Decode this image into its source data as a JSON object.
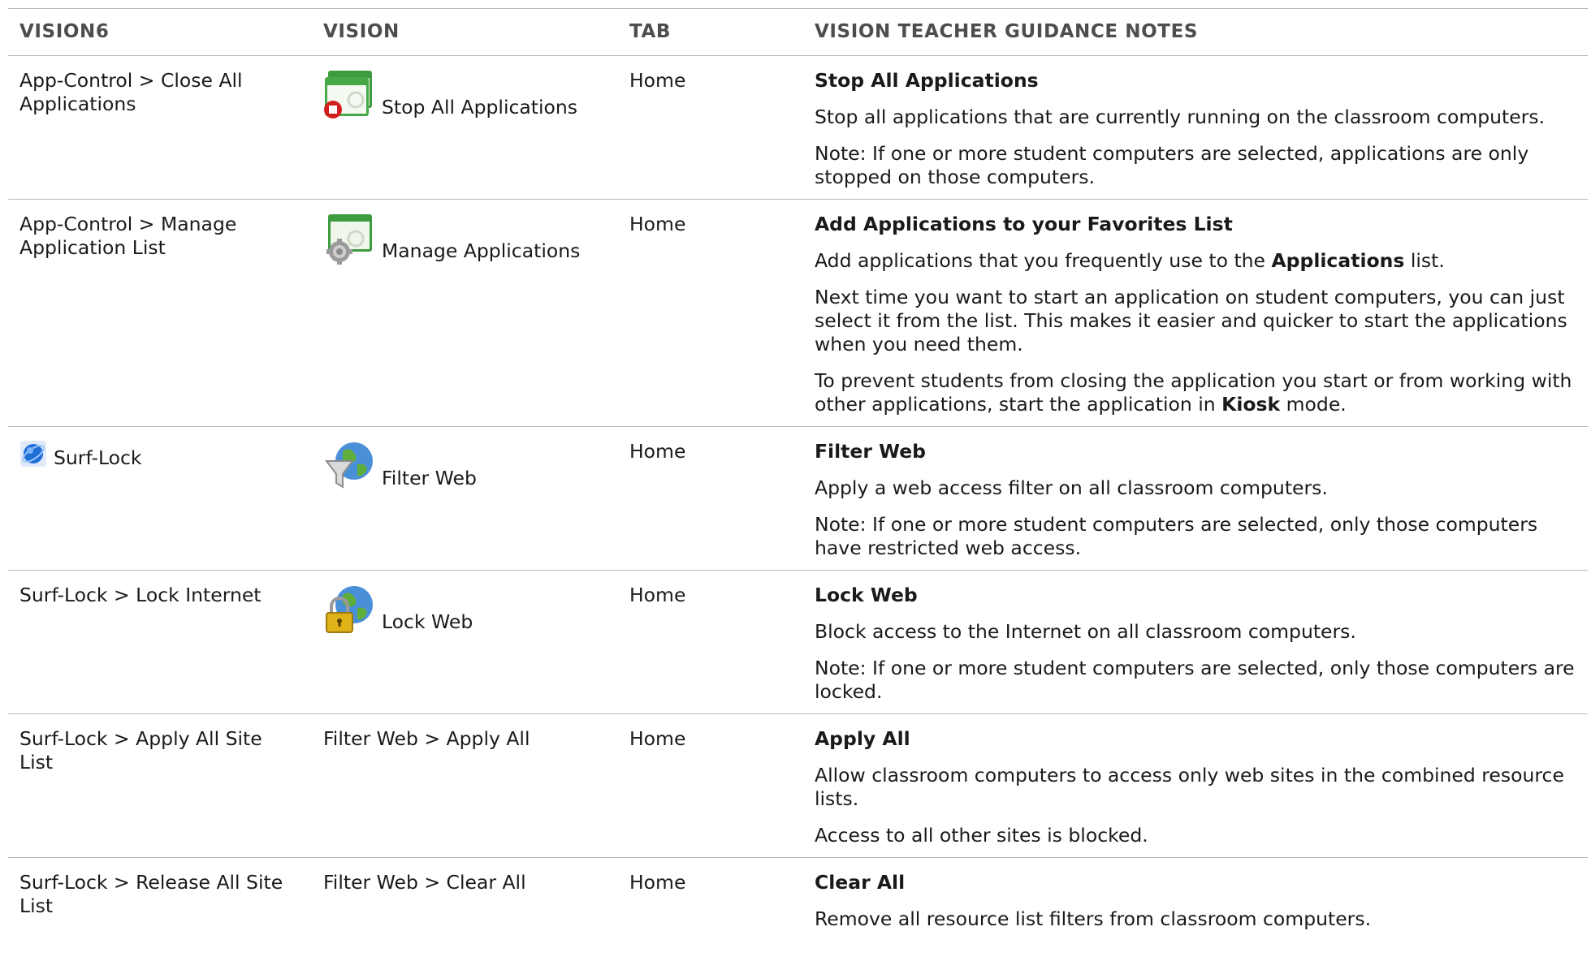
{
  "headers": {
    "vision6": "VISION6",
    "vision": "VISION",
    "tab": "TAB",
    "notes": "VISION TEACHER GUIDANCE NOTES"
  },
  "rows": [
    {
      "vision6": "App-Control > Close All Applications",
      "vision": "Stop All Applications",
      "vision_icon": "stop-applications-icon",
      "tab": "Home",
      "note_title": "Stop All Applications",
      "note_p1": "Stop all applications that are currently running on the classroom computers.",
      "note_p2": "Note:  If one or more student computers are selected, applications are only stopped on those computers."
    },
    {
      "vision6": "App-Control > Manage Application List",
      "vision": "Manage Applications",
      "vision_icon": "manage-applications-icon",
      "tab": "Home",
      "note_title": "Add Applications to your Favorites List",
      "note_p1_pre": "Add applications that you frequently use to the ",
      "note_p1_bold": "Applications",
      "note_p1_post": " list.",
      "note_p2": "Next time you want to start an application on student computers, you can just select it from the list. This makes it easier and quicker to start the applications when you need them.",
      "note_p3_pre": "To prevent students from closing the application you start or from working with other applications, start the application in ",
      "note_p3_bold": "Kiosk",
      "note_p3_post": " mode."
    },
    {
      "vision6": "Surf-Lock",
      "vision6_icon": "surf-lock-icon",
      "vision": "Filter Web",
      "vision_icon": "filter-web-icon",
      "tab": "Home",
      "note_title": "Filter Web",
      "note_p1": "Apply a web access filter on all classroom computers.",
      "note_p2": "Note: If one or more student computers are selected, only those computers have restricted web access."
    },
    {
      "vision6": "Surf-Lock > Lock Internet",
      "vision": "Lock Web",
      "vision_icon": "lock-web-icon",
      "tab": "Home",
      "note_title": "Lock Web",
      "note_p1": "Block access to the Internet on all classroom computers.",
      "note_p2": "Note: If one or more student computers are selected, only those computers are locked."
    },
    {
      "vision6": "Surf-Lock > Apply All Site List",
      "vision": "Filter Web > Apply All",
      "tab": "Home",
      "note_title": "Apply All",
      "note_p1": "Allow classroom computers to access only web sites in the combined resource lists.",
      "note_p2": "Access to all other sites is blocked."
    },
    {
      "vision6": "Surf-Lock > Release All Site List",
      "vision": "Filter Web > Clear All",
      "tab": "Home",
      "note_title": "Clear All",
      "note_p1": "Remove all resource list filters from classroom computers."
    }
  ]
}
